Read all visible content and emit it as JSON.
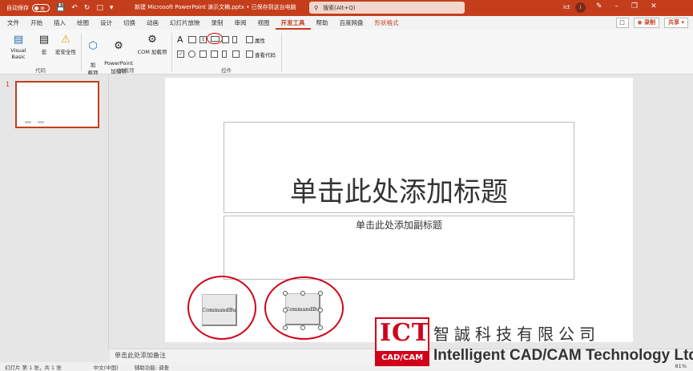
{
  "titlebar": {
    "autosave": "自动保存",
    "autosave_state": "关",
    "doc_title": "新建 Microsoft PowerPoint 演示文稿.pptx • 已保存到这台电脑",
    "search_placeholder": "搜索(Alt+Q)",
    "user": "ict"
  },
  "tabs": [
    "文件",
    "开始",
    "插入",
    "绘图",
    "设计",
    "切换",
    "动画",
    "幻灯片放映",
    "录制",
    "审阅",
    "视图",
    "开发工具",
    "帮助",
    "百度网盘",
    "形状格式"
  ],
  "active_tab": "开发工具",
  "menu_right": {
    "record": "录制",
    "share": "共享"
  },
  "ribbon": {
    "code_group": {
      "label": "代码",
      "vb": "Visual Basic",
      "macro": "宏",
      "security": "宏安全性"
    },
    "addins_group": {
      "label": "加载项",
      "addin": "加\n载项",
      "ppt_addin": "PowerPoint\n加载项",
      "com_addin": "COM 加载项"
    },
    "controls_group": {
      "label": "控件",
      "properties": "属性",
      "view_code": "查看代码"
    }
  },
  "thumbs": {
    "number": "1"
  },
  "slide": {
    "title_placeholder": "单击此处添加标题",
    "subtitle_placeholder": "单击此处添加副标题",
    "button1": "CommandBu",
    "button2": "CommandBu"
  },
  "notes": "单击此处添加备注",
  "status": {
    "slide_info": "幻灯片 第 1 张，共 1 张",
    "language": "中文(中国)",
    "accessibility": "辅助功能: 调查",
    "zoom": "81%"
  },
  "watermark": {
    "logo": "ICT",
    "logo_sub": "CAD/CAM",
    "cn": "智誠科技有限公司",
    "en": "Intelligent CAD/CAM Technology Ltd."
  },
  "colors": {
    "accent": "#c43e1c",
    "highlight": "#d0021b"
  }
}
